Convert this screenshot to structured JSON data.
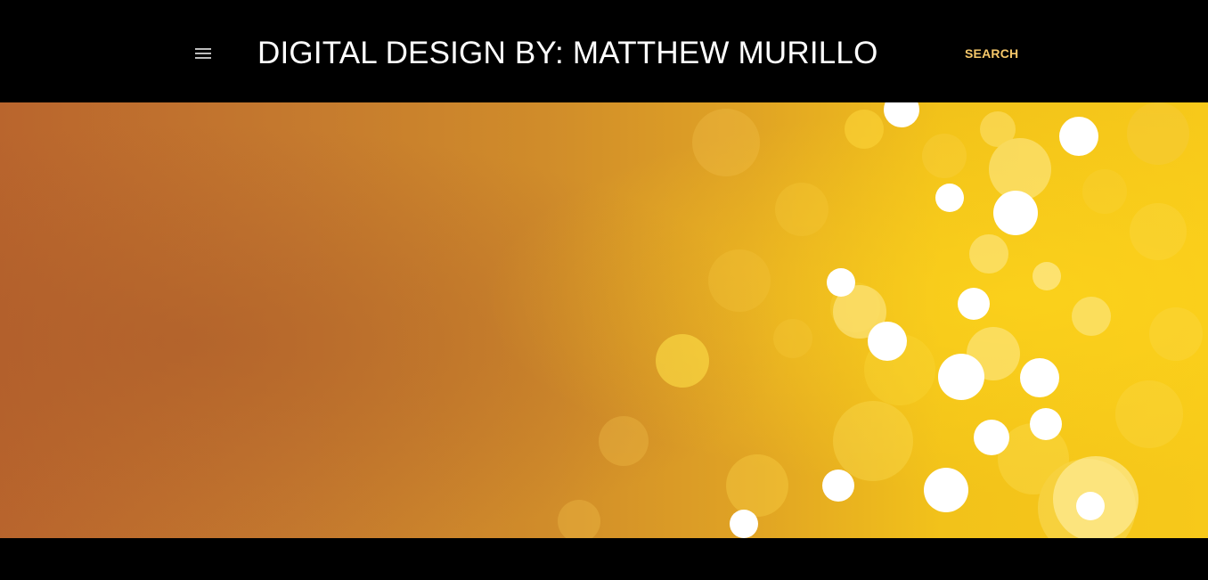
{
  "header": {
    "menu_icon": "hamburger-menu-icon",
    "title": "DIGITAL DESIGN BY: MATTHEW MURILLO",
    "search_label": "SEARCH"
  },
  "colors": {
    "header_background": "#000000",
    "title_text": "#ffffff",
    "search_accent": "#f6c86a",
    "hero_left": "#b9652d",
    "hero_right": "#f7c91a"
  },
  "hero": {
    "description_icon": "bokeh-banner-image"
  }
}
